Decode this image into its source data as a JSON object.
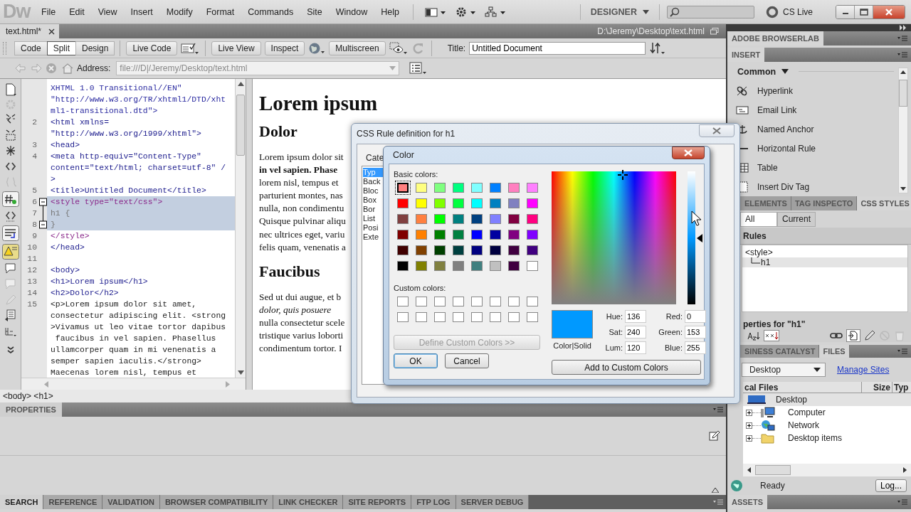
{
  "app": {
    "logo": "Dw",
    "menus": [
      "File",
      "Edit",
      "View",
      "Insert",
      "Modify",
      "Format",
      "Commands",
      "Site",
      "Window",
      "Help"
    ],
    "workspace": "DESIGNER",
    "cs_live": "CS Live"
  },
  "document": {
    "tab": "text.html*",
    "path": "D:\\Jeremy\\Desktop\\text.html"
  },
  "toolbar": {
    "views": [
      {
        "label": "Code",
        "selected": false
      },
      {
        "label": "Split",
        "selected": true
      },
      {
        "label": "Design",
        "selected": false
      }
    ],
    "live_code": "Live Code",
    "live_view": "Live View",
    "inspect": "Inspect",
    "multiscreen": "Multiscreen",
    "title_label": "Title:",
    "title_value": "Untitled Document"
  },
  "address": {
    "label": "Address:",
    "value": "file:///D|/Jeremy/Desktop/text.html"
  },
  "code": [
    {
      "text": "XHTML 1.0 Transitional//EN\"",
      "kind": "doctype",
      "highlighted": false
    },
    {
      "text": "\"http://www.w3.org/TR/xhtml1/DTD/xht",
      "kind": "doctype",
      "highlighted": false
    },
    {
      "text": "ml1-transitional.dtd\">",
      "kind": "doctype",
      "highlighted": false
    },
    {
      "num": "2",
      "text": "<html xmlns=",
      "kind": "tag",
      "highlighted": false
    },
    {
      "text": "\"http://www.w3.org/1999/xhtml\">",
      "kind": "tag",
      "highlighted": false
    },
    {
      "num": "3",
      "text": "<head>",
      "kind": "tag",
      "highlighted": false
    },
    {
      "num": "4",
      "text": "<meta http-equiv=\"Content-Type\"",
      "kind": "tag",
      "highlighted": false
    },
    {
      "text": "content=\"text/html; charset=utf-8\" /",
      "kind": "tag",
      "highlighted": false
    },
    {
      "text": ">",
      "kind": "tag",
      "highlighted": false
    },
    {
      "num": "5",
      "text": "<title>Untitled Document</title>",
      "kind": "tag",
      "highlighted": false
    },
    {
      "num": "6",
      "text": "<style type=\"text/css\">",
      "kind": "style",
      "highlighted": true,
      "fold": true
    },
    {
      "num": "7",
      "text": "h1 {",
      "kind": "css",
      "highlighted": true
    },
    {
      "num": "8",
      "text": "}",
      "kind": "css",
      "highlighted": true,
      "fold": true
    },
    {
      "num": "9",
      "text": "</style>",
      "kind": "style",
      "highlighted": false
    },
    {
      "num": "10",
      "text": "</head>",
      "kind": "tag",
      "highlighted": false
    },
    {
      "num": "11",
      "highlighted": false
    },
    {
      "num": "12",
      "text": "<body>",
      "kind": "tag",
      "highlighted": false
    },
    {
      "num": "13",
      "text": "<h1>Lorem ipsum</h1>",
      "kind": "tag",
      "highlighted": false
    },
    {
      "num": "14",
      "text": "<h2>Dolor</h2>",
      "kind": "tag",
      "highlighted": false
    },
    {
      "num": "15",
      "text": "<p>Lorem ipsum dolor sit amet,",
      "kind": "text",
      "highlighted": false
    },
    {
      "text": "consectetur adipiscing elit. <strong",
      "kind": "text",
      "highlighted": false
    },
    {
      "text": ">Vivamus ut leo vitae tortor dapibus",
      "kind": "text",
      "highlighted": false
    },
    {
      "text": " faucibus in vel sapien. Phasellus",
      "kind": "text",
      "highlighted": false
    },
    {
      "text": "ullamcorper quam in mi venenatis a",
      "kind": "text",
      "highlighted": false
    },
    {
      "text": "semper sapien iaculis.</strong>",
      "kind": "text",
      "highlighted": false
    },
    {
      "text": "Maecenas lorem nisl, tempus et",
      "kind": "text",
      "highlighted": false
    }
  ],
  "design": [
    {
      "kind": "h1",
      "lines": [
        {
          "text": "Lorem ipsum",
          "kind": "plain"
        }
      ]
    },
    {
      "kind": "h2",
      "lines": [
        {
          "text": "Dolor",
          "kind": "plain"
        }
      ]
    },
    {
      "kind": "p",
      "lines": [
        {
          "text": "Lorem ipsum dolor sit",
          "kind": "plain"
        },
        {
          "text": "in vel sapien. Phase",
          "kind": "strong"
        },
        {
          "text": "lorem nisl, tempus et",
          "kind": "plain"
        },
        {
          "text": "parturient montes, nas",
          "kind": "plain"
        },
        {
          "text": "nulla, non condimentu",
          "kind": "plain"
        },
        {
          "text": "Quisque pulvinar aliqu",
          "kind": "plain"
        },
        {
          "text": "nec ultrices eget, variu",
          "kind": "plain"
        },
        {
          "text": "felis quam, venenatis a",
          "kind": "plain"
        }
      ]
    },
    {
      "kind": "h2",
      "lines": [
        {
          "text": "Faucibus",
          "kind": "plain"
        }
      ]
    },
    {
      "kind": "p",
      "lines": [
        {
          "text": "Sed ut dui augue, et b",
          "kind": "plain"
        },
        {
          "text": "dolor, quis posuere",
          "kind": "em"
        },
        {
          "text": "nulla consectetur scele",
          "kind": "plain"
        },
        {
          "text": "tristique varius loborti",
          "kind": "plain"
        },
        {
          "text": "condimentum tortor. I",
          "kind": "plain"
        }
      ]
    }
  ],
  "tag_selector": "<body> <h1>",
  "properties": {
    "title": "PROPERTIES"
  },
  "results_tabs": [
    {
      "label": "SEARCH",
      "selected": true
    },
    {
      "label": "REFERENCE",
      "selected": false
    },
    {
      "label": "VALIDATION",
      "selected": false
    },
    {
      "label": "BROWSER COMPATIBILITY",
      "selected": false
    },
    {
      "label": "LINK CHECKER",
      "selected": false
    },
    {
      "label": "SITE REPORTS",
      "selected": false
    },
    {
      "label": "FTP LOG",
      "selected": false
    },
    {
      "label": "SERVER DEBUG",
      "selected": false
    }
  ],
  "panels": {
    "browserlab": "ADOBE BROWSERLAB",
    "insert": {
      "title": "INSERT",
      "category": "Common",
      "items": [
        {
          "label": "Hyperlink",
          "kind": "hyperlink"
        },
        {
          "label": "Email Link",
          "kind": "email"
        },
        {
          "label": "Named Anchor",
          "kind": "anchor"
        },
        {
          "label": "Horizontal Rule",
          "kind": "rule"
        },
        {
          "label": "Table",
          "kind": "table"
        },
        {
          "label": "Insert Div Tag",
          "kind": "div"
        }
      ]
    },
    "css_tabs": [
      {
        "label": "ELEMENTS",
        "selected": false
      },
      {
        "label": "TAG INSPECTO",
        "selected": false
      },
      {
        "label": "CSS STYLES",
        "selected": true
      }
    ],
    "css_modes": [
      {
        "label": "All",
        "selected": true
      },
      {
        "label": "Current",
        "selected": false
      }
    ],
    "rules_header": "Rules",
    "rules": [
      {
        "label": "<style>",
        "selected": false,
        "children": [
          {
            "label": "h1",
            "selected": true
          }
        ]
      }
    ],
    "properties_for": "perties for \"h1\"",
    "files_tabs": [
      {
        "label": "SINESS CATALYST",
        "selected": false
      },
      {
        "label": "FILES",
        "selected": true
      }
    ],
    "site": "Desktop",
    "manage_sites": "Manage Sites",
    "file_columns": [
      "cal Files",
      "Size",
      "Typ"
    ],
    "files": [
      {
        "label": "Desktop",
        "kind": "desktop",
        "selected": true,
        "children": [
          {
            "label": "Computer",
            "kind": "computer",
            "expanded": false,
            "selected": false
          },
          {
            "label": "Network",
            "kind": "network",
            "expanded": false,
            "selected": false
          },
          {
            "label": "Desktop items",
            "kind": "folder",
            "expanded": false,
            "selected": false
          }
        ]
      }
    ],
    "status": "Ready",
    "log": "Log...",
    "assets": "ASSETS"
  },
  "css_rule_dialog": {
    "title": "CSS Rule definition for h1",
    "category_label": "Cate",
    "categories": [
      {
        "label": "Typ",
        "selected": true
      },
      {
        "label": "Back",
        "selected": false
      },
      {
        "label": "Bloc",
        "selected": false
      },
      {
        "label": "Box",
        "selected": false
      },
      {
        "label": "Bor",
        "selected": false
      },
      {
        "label": "List",
        "selected": false
      },
      {
        "label": "Posi",
        "selected": false
      },
      {
        "label": "Exte",
        "selected": false
      }
    ]
  },
  "color_dialog": {
    "title": "Color",
    "basic_label": "Basic colors:",
    "basic_colors": [
      {
        "color": "#ff8080",
        "selected": true
      },
      {
        "color": "#ffff80",
        "selected": false
      },
      {
        "color": "#80ff80",
        "selected": false
      },
      {
        "color": "#00ff80",
        "selected": false
      },
      {
        "color": "#80ffff",
        "selected": false
      },
      {
        "color": "#0080ff",
        "selected": false
      },
      {
        "color": "#ff80c0",
        "selected": false
      },
      {
        "color": "#ff80ff",
        "selected": false
      },
      {
        "color": "#ff0000",
        "selected": false
      },
      {
        "color": "#ffff00",
        "selected": false
      },
      {
        "color": "#80ff00",
        "selected": false
      },
      {
        "color": "#00ff40",
        "selected": false
      },
      {
        "color": "#00ffff",
        "selected": false
      },
      {
        "color": "#0080c0",
        "selected": false
      },
      {
        "color": "#8080c0",
        "selected": false
      },
      {
        "color": "#ff00ff",
        "selected": false
      },
      {
        "color": "#804040",
        "selected": false
      },
      {
        "color": "#ff8040",
        "selected": false
      },
      {
        "color": "#00ff00",
        "selected": false
      },
      {
        "color": "#008080",
        "selected": false
      },
      {
        "color": "#004080",
        "selected": false
      },
      {
        "color": "#8080ff",
        "selected": false
      },
      {
        "color": "#800040",
        "selected": false
      },
      {
        "color": "#ff0080",
        "selected": false
      },
      {
        "color": "#800000",
        "selected": false
      },
      {
        "color": "#ff8000",
        "selected": false
      },
      {
        "color": "#008000",
        "selected": false
      },
      {
        "color": "#008040",
        "selected": false
      },
      {
        "color": "#0000ff",
        "selected": false
      },
      {
        "color": "#0000a0",
        "selected": false
      },
      {
        "color": "#800080",
        "selected": false
      },
      {
        "color": "#8000ff",
        "selected": false
      },
      {
        "color": "#400000",
        "selected": false
      },
      {
        "color": "#804000",
        "selected": false
      },
      {
        "color": "#004000",
        "selected": false
      },
      {
        "color": "#004040",
        "selected": false
      },
      {
        "color": "#000080",
        "selected": false
      },
      {
        "color": "#000040",
        "selected": false
      },
      {
        "color": "#400040",
        "selected": false
      },
      {
        "color": "#400080",
        "selected": false
      },
      {
        "color": "#000000",
        "selected": false
      },
      {
        "color": "#808000",
        "selected": false
      },
      {
        "color": "#808040",
        "selected": false
      },
      {
        "color": "#808080",
        "selected": false
      },
      {
        "color": "#408080",
        "selected": false
      },
      {
        "color": "#c0c0c0",
        "selected": false
      },
      {
        "color": "#400040",
        "selected": false
      },
      {
        "color": "#ffffff",
        "selected": false
      }
    ],
    "custom_label": "Custom colors:",
    "define_button": {
      "label": "Define Custom Colors >>",
      "disabled": true
    },
    "ok": "OK",
    "cancel": "Cancel",
    "preview": {
      "color": "#0099ff",
      "label": "Color|Solid"
    },
    "lum_slider": {
      "level": 0.5
    },
    "fields": [
      {
        "label": "Hue:",
        "value": "136"
      },
      {
        "label": "Red:",
        "value": "0"
      },
      {
        "label": "Sat:",
        "value": "240"
      },
      {
        "label": "Green:",
        "value": "153"
      },
      {
        "label": "Lum:",
        "value": "120"
      },
      {
        "label": "Blue:",
        "value": "255"
      }
    ],
    "add_button": "Add to Custom Colors"
  }
}
